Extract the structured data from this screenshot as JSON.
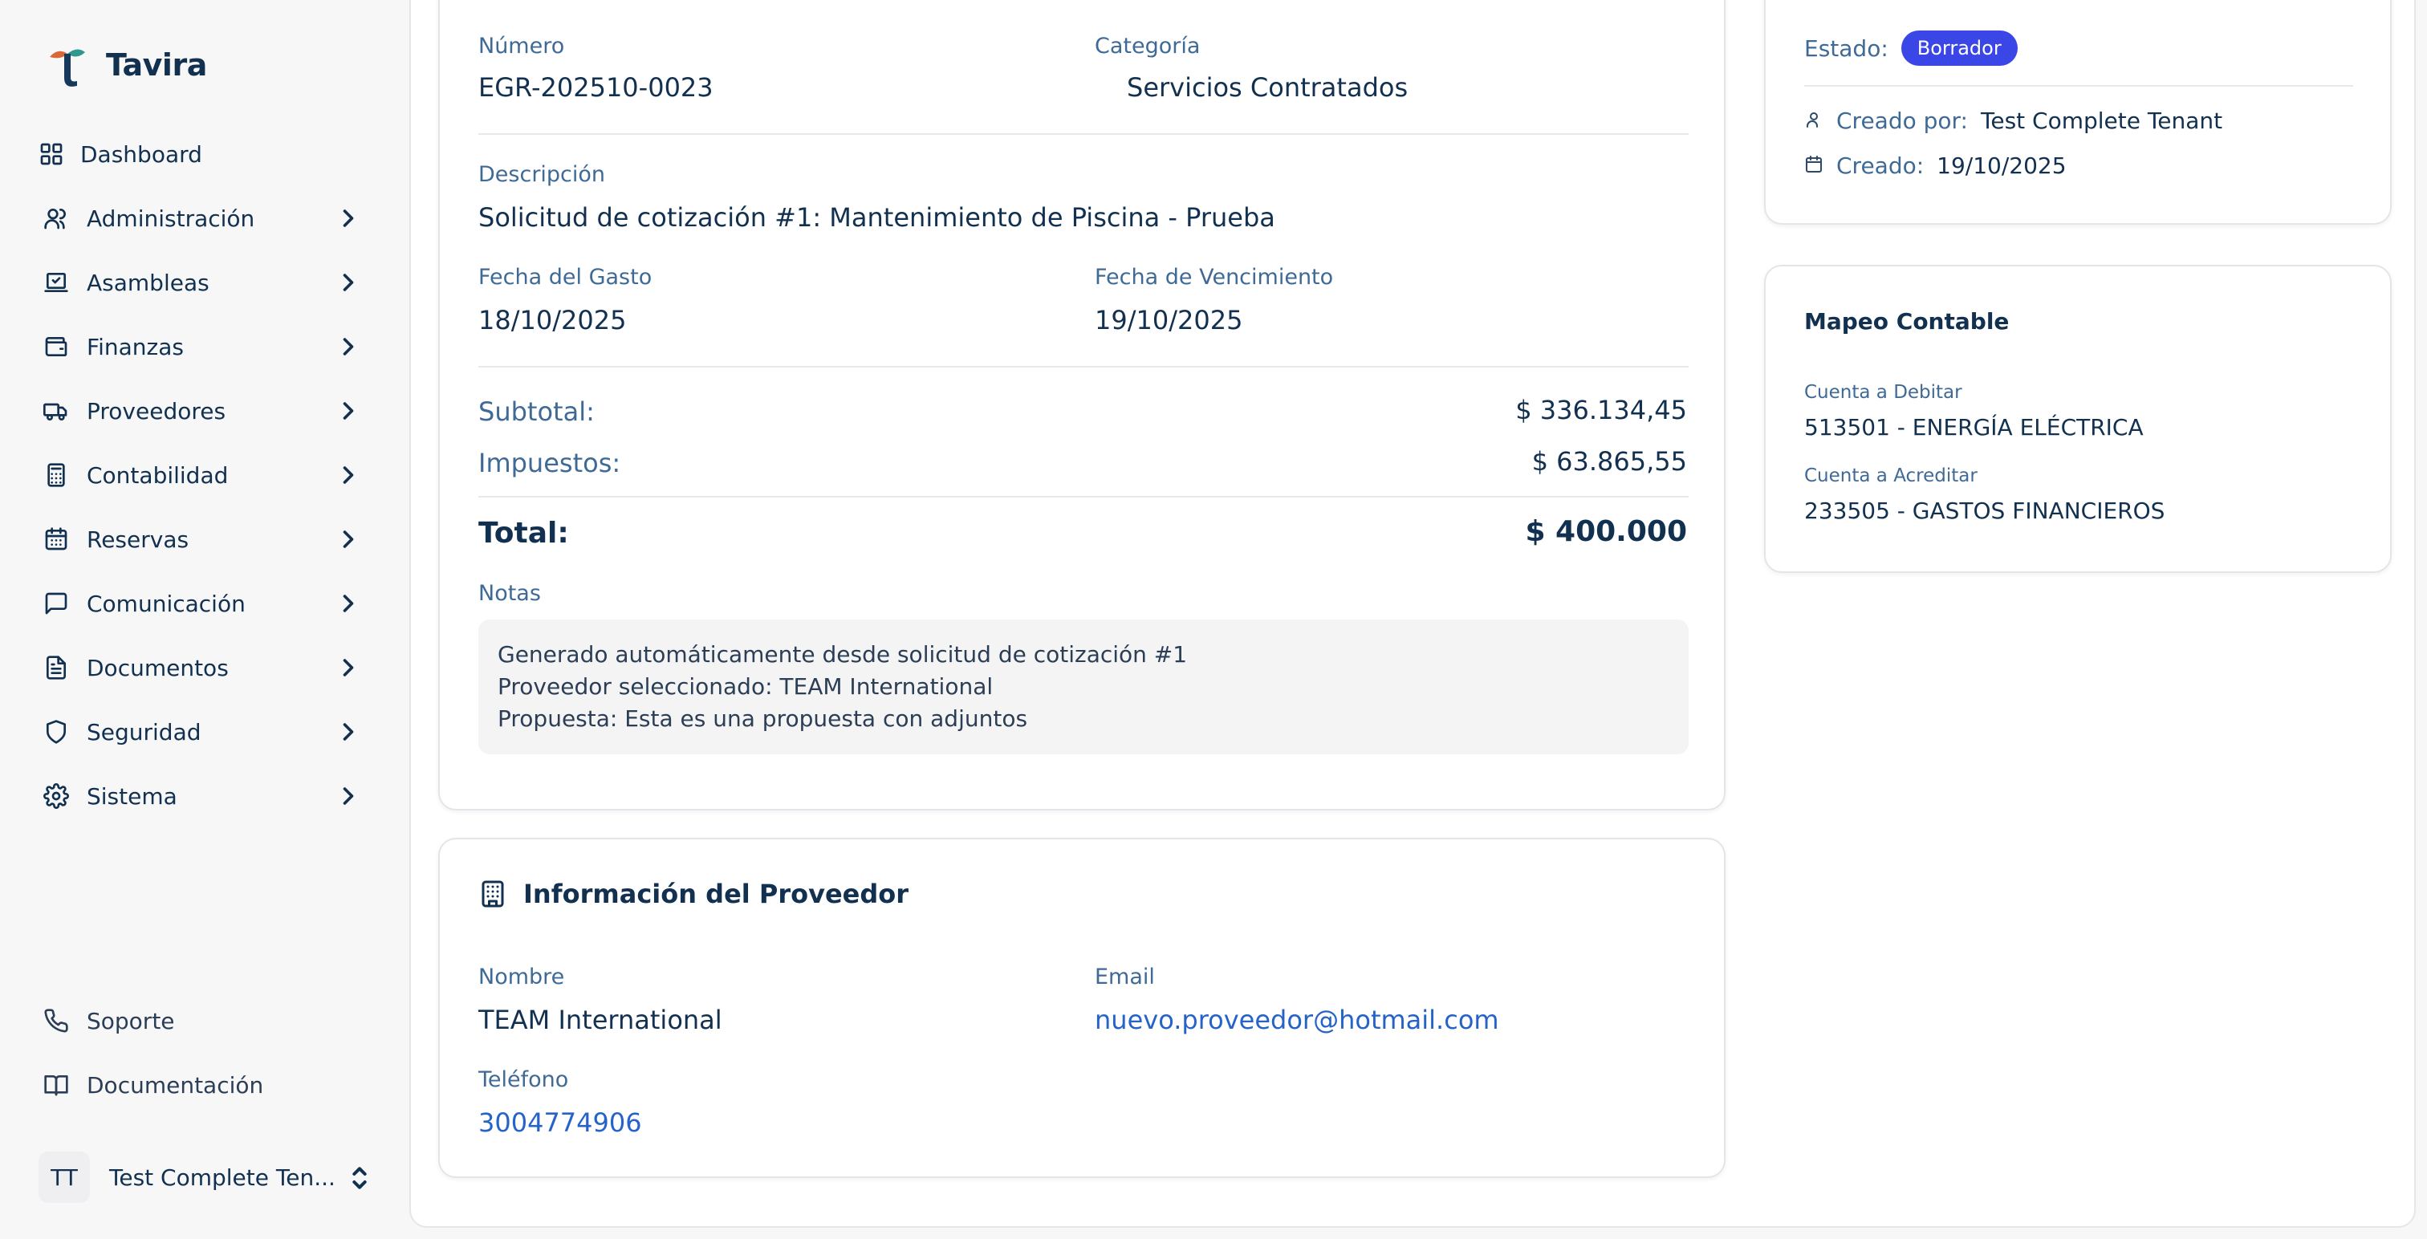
{
  "brand": {
    "name": "Tavira"
  },
  "sidebar": {
    "items": [
      {
        "label": "Dashboard",
        "icon": "grid-icon"
      },
      {
        "label": "Administración",
        "icon": "users-icon"
      },
      {
        "label": "Asambleas",
        "icon": "vote-icon"
      },
      {
        "label": "Finanzas",
        "icon": "wallet-icon"
      },
      {
        "label": "Proveedores",
        "icon": "truck-icon"
      },
      {
        "label": "Contabilidad",
        "icon": "calculator-icon"
      },
      {
        "label": "Reservas",
        "icon": "calendar-icon"
      },
      {
        "label": "Comunicación",
        "icon": "message-icon"
      },
      {
        "label": "Documentos",
        "icon": "file-text-icon"
      },
      {
        "label": "Seguridad",
        "icon": "shield-icon"
      },
      {
        "label": "Sistema",
        "icon": "gear-icon"
      }
    ],
    "bottom": [
      {
        "label": "Soporte",
        "icon": "phone-icon"
      },
      {
        "label": "Documentación",
        "icon": "book-icon"
      }
    ],
    "user": {
      "initials": "TT",
      "name": "Test Complete Ten..."
    }
  },
  "expense": {
    "numero_label": "Número",
    "numero": "EGR-202510-0023",
    "categoria_label": "Categoría",
    "categoria": "Servicios Contratados",
    "descripcion_label": "Descripción",
    "descripcion": "Solicitud de cotización #1: Mantenimiento de Piscina - Prueba",
    "fecha_gasto_label": "Fecha del Gasto",
    "fecha_gasto": "18/10/2025",
    "fecha_venc_label": "Fecha de Vencimiento",
    "fecha_venc": "19/10/2025",
    "subtotal_label": "Subtotal:",
    "subtotal": "$ 336.134,45",
    "impuestos_label": "Impuestos:",
    "impuestos": "$ 63.865,55",
    "total_label": "Total:",
    "total": "$ 400.000",
    "notas_label": "Notas",
    "notas": [
      "Generado automáticamente desde solicitud de cotización #1",
      "Proveedor seleccionado: TEAM International",
      "Propuesta: Esta es una propuesta con adjuntos"
    ]
  },
  "provider": {
    "title": "Información del Proveedor",
    "nombre_label": "Nombre",
    "nombre": "TEAM International",
    "email_label": "Email",
    "email": "nuevo.proveedor@hotmail.com",
    "telefono_label": "Teléfono",
    "telefono": "3004774906"
  },
  "status": {
    "estado_label": "Estado:",
    "estado": "Borrador",
    "creado_por_label": "Creado por:",
    "creado_por": "Test Complete Tenant",
    "creado_label": "Creado:",
    "creado": "19/10/2025"
  },
  "accounting": {
    "title": "Mapeo Contable",
    "debit_label": "Cuenta a Debitar",
    "debit": "513501 - ENERGÍA ELÉCTRICA",
    "credit_label": "Cuenta a Acreditar",
    "credit": "233505 - GASTOS FINANCIEROS"
  },
  "colors": {
    "accent": "#3b46e6",
    "link": "#2563c9",
    "text": "#12304f",
    "label": "#3f6a96"
  }
}
